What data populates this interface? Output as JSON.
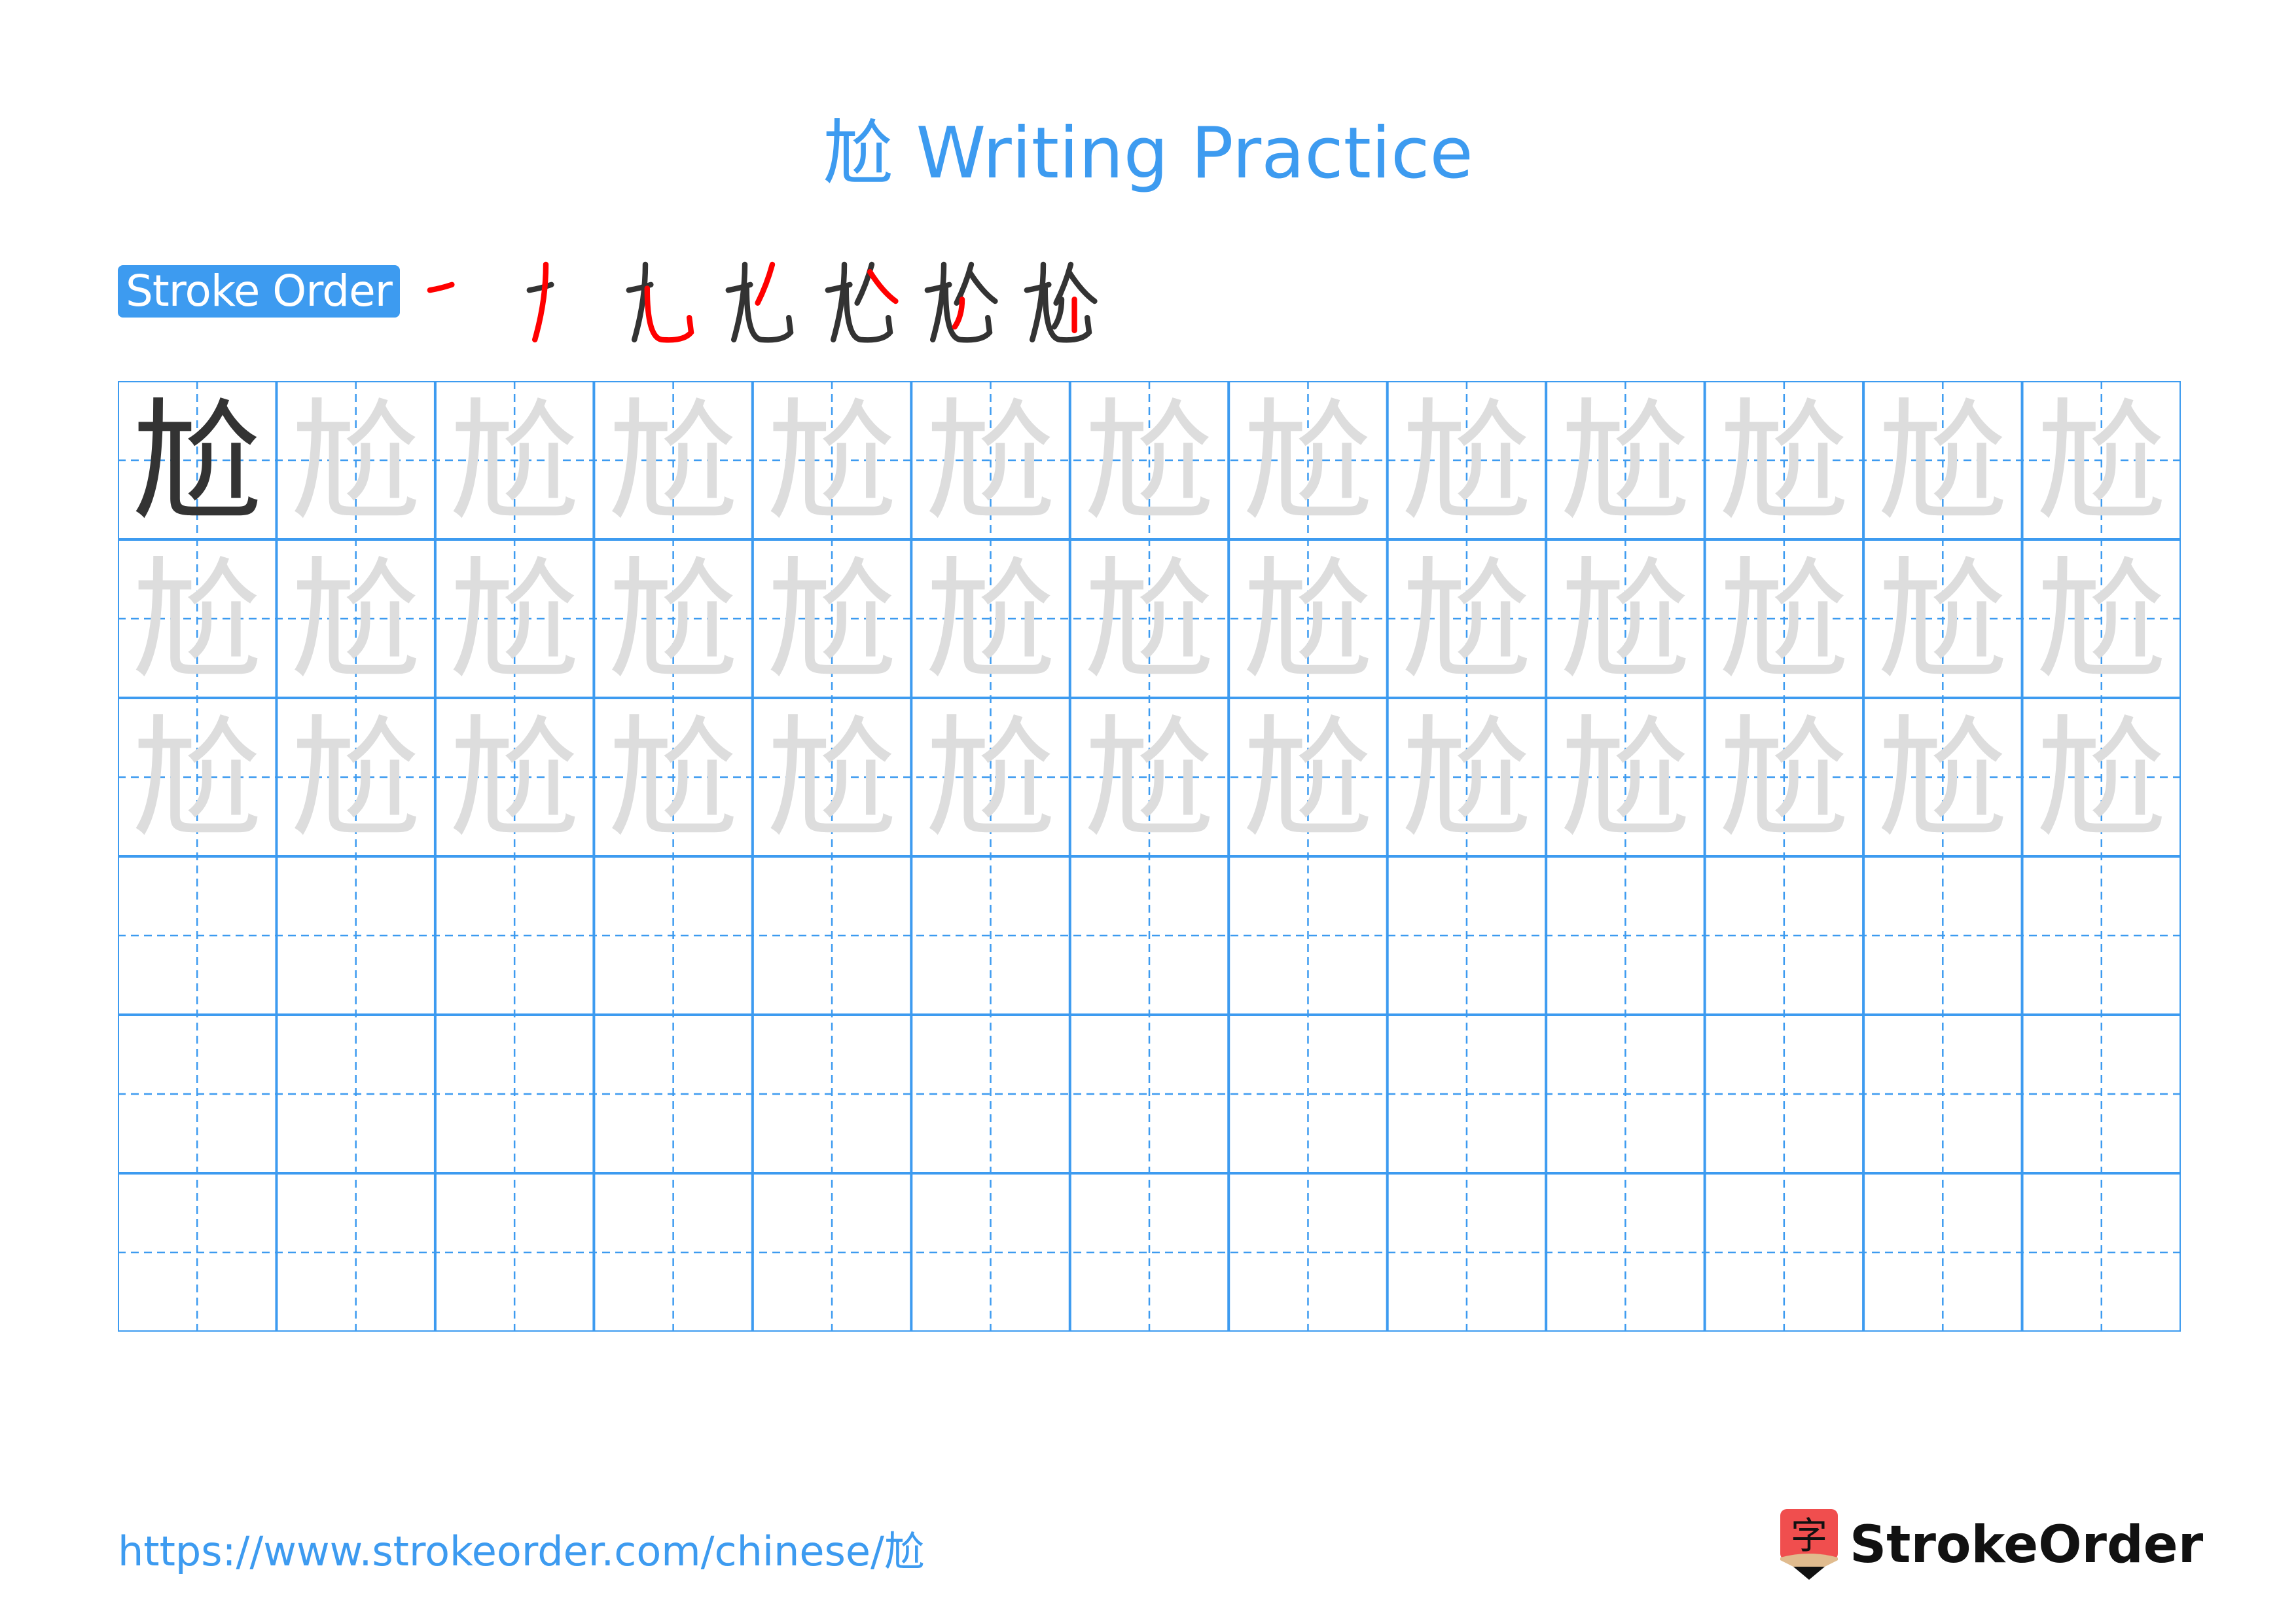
{
  "page": {
    "title": "尬 Writing Practice",
    "character": "尬"
  },
  "stroke_order": {
    "badge_label": "Stroke Order",
    "step_count": 7,
    "colors": {
      "current_stroke": "#ff0000",
      "previous_strokes": "#333333"
    }
  },
  "grid": {
    "rows": 6,
    "cols": 13,
    "model_character_color": "#333333",
    "trace_character_color": "#dddddd",
    "line_color": "#3d9bf0",
    "rows_content": [
      "model+trace",
      "trace",
      "trace",
      "empty",
      "empty",
      "empty"
    ]
  },
  "footer": {
    "url": "https://www.strokeorder.com/chinese/尬",
    "logo_glyph": "字",
    "logo_text": "StrokeOrder"
  },
  "colors": {
    "accent": "#3d9bf0",
    "logo_red": "#f04e4e",
    "logo_tan": "#e0bb8e"
  }
}
